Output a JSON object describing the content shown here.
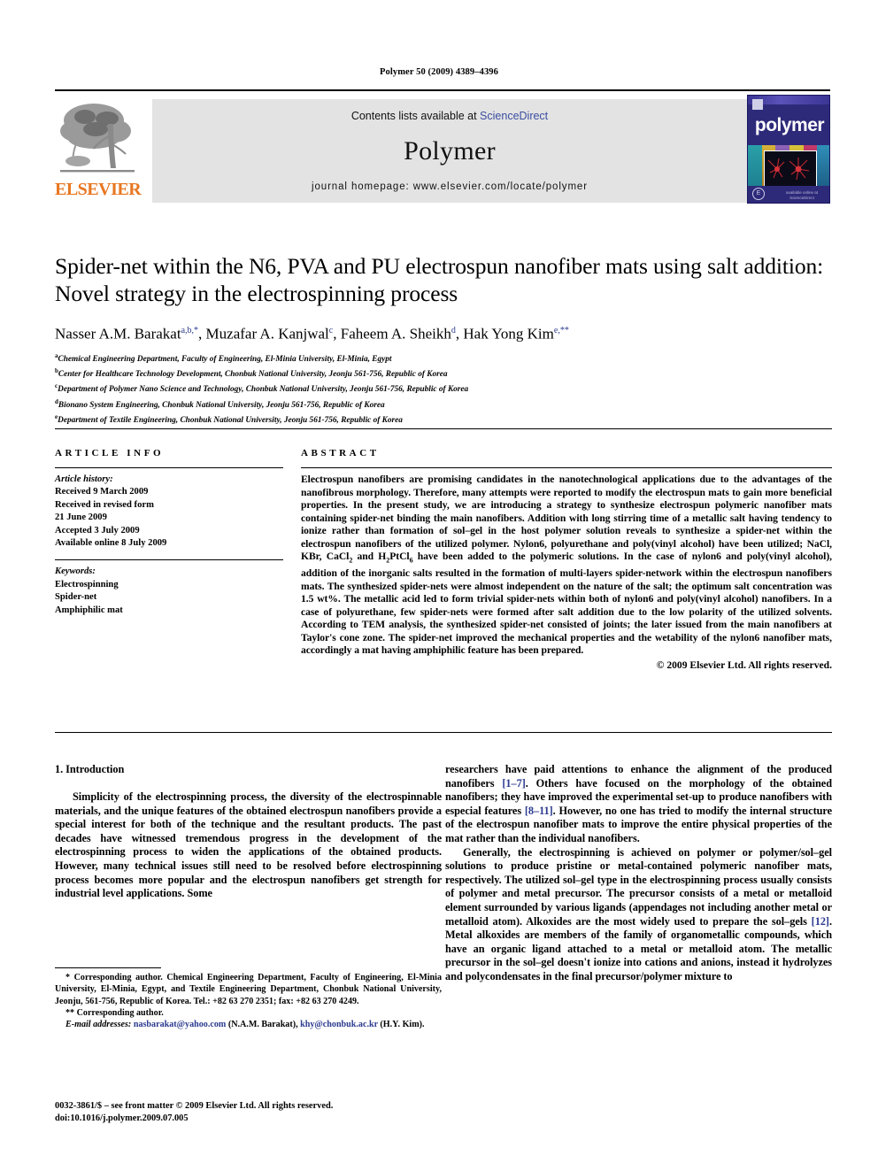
{
  "running_head": "Polymer 50 (2009) 4389–4396",
  "masthead": {
    "publisher_logo_name": "elsevier-tree-logo",
    "publisher_wordmark": "ELSEVIER",
    "contents_prefix": "Contents lists available at ",
    "contents_link": "ScienceDirect",
    "journal_name": "Polymer",
    "homepage_line": "journal homepage: www.elsevier.com/locate/polymer",
    "cover": {
      "title": "polymer",
      "badge": "E",
      "footer_text": "available online at\nScienceDirect"
    }
  },
  "article": {
    "title": "Spider-net within the N6, PVA and PU electrospun nanofiber mats using salt addition: Novel strategy in the electrospinning process",
    "authors_html": "Nasser A.M. Barakat<sup>a,b,</sup><sup>*</sup>, Muzafar A. Kanjwal<sup>c</sup>, Faheem A. Sheikh<sup>d</sup>, Hak Yong Kim<sup>e,</sup><sup>**</sup>",
    "affiliations": [
      {
        "marker": "a",
        "text": "Chemical Engineering Department, Faculty of Engineering, El-Minia University, El-Minia, Egypt"
      },
      {
        "marker": "b",
        "text": "Center for Healthcare Technology Development, Chonbuk National University, Jeonju 561-756, Republic of Korea"
      },
      {
        "marker": "c",
        "text": "Department of Polymer Nano Science and Technology, Chonbuk National University, Jeonju 561-756, Republic of Korea"
      },
      {
        "marker": "d",
        "text": "Bionano System Engineering, Chonbuk National University, Jeonju 561-756, Republic of Korea"
      },
      {
        "marker": "e",
        "text": "Department of Textile Engineering, Chonbuk National University, Jeonju 561-756, Republic of Korea"
      }
    ]
  },
  "article_info": {
    "heading": "ARTICLE INFO",
    "history_label": "Article history:",
    "history": [
      "Received 9 March 2009",
      "Received in revised form",
      "21 June 2009",
      "Accepted 3 July 2009",
      "Available online 8 July 2009"
    ],
    "keywords_label": "Keywords:",
    "keywords": [
      "Electrospinning",
      "Spider-net",
      "Amphiphilic mat"
    ]
  },
  "abstract": {
    "heading": "ABSTRACT",
    "body_html": "Electrospun nanofibers are promising candidates in the nanotechnological applications due to the advantages of the nanofibrous morphology. Therefore, many attempts were reported to modify the electrospun mats to gain more beneficial properties. In the present study, we are introducing a strategy to synthesize electrospun polymeric nanofiber mats containing spider-net binding the main nanofibers. Addition with long stirring time of a metallic salt having tendency to ionize rather than formation of sol–gel in the host polymer solution reveals to synthesize a spider-net within the electrospun nanofibers of the utilized polymer. Nylon6, polyurethane and poly(vinyl alcohol) have been utilized; NaCl, KBr, CaCl<sub>2</sub> and H<sub>2</sub>PtCl<sub>6</sub> have been added to the polymeric solutions. In the case of nylon6 and poly(vinyl alcohol), addition of the inorganic salts resulted in the formation of multi-layers spider-network within the electrospun nanofibers mats. The synthesized spider-nets were almost independent on the nature of the salt; the optimum salt concentration was 1.5 wt%. The metallic acid led to form trivial spider-nets within both of nylon6 and poly(vinyl alcohol) nanofibers. In a case of polyurethane, few spider-nets were formed after salt addition due to the low polarity of the utilized solvents. According to TEM analysis, the synthesized spider-net consisted of joints; the later issued from the main nanofibers at Taylor's cone zone. The spider-net improved the mechanical properties and the wetability of the nylon6 nanofiber mats, accordingly a mat having amphiphilic feature has been prepared.",
    "copyright": "© 2009 Elsevier Ltd. All rights reserved."
  },
  "body": {
    "section_number_title": "1. Introduction",
    "left_paragraph": "Simplicity of the electrospinning process, the diversity of the electrospinnable materials, and the unique features of the obtained electrospun nanofibers provide a special interest for both of the technique and the resultant products. The past decades have witnessed tremendous progress in the development of the electrospinning process to widen the applications of the obtained products. However, many technical issues still need to be resolved before electrospinning process becomes more popular and the electrospun nanofibers get strength for industrial level applications. Some",
    "right_paragraph_1_html": "researchers have paid attentions to enhance the alignment of the produced nanofibers <span class=\"ref\">[1–7]</span>. Others have focused on the morphology of the obtained nanofibers; they have improved the experimental set-up to produce nanofibers with especial features <span class=\"ref\">[8–11]</span>. However, no one has tried to modify the internal structure of the electrospun nanofiber mats to improve the entire physical properties of the mat rather than the individual nanofibers.",
    "right_paragraph_2_html": "Generally, the electrospinning is achieved on polymer or polymer/sol–gel solutions to produce pristine or metal-contained polymeric nanofiber mats, respectively. The utilized sol–gel type in the electrospinning process usually consists of polymer and metal precursor. The precursor consists of a metal or metalloid element surrounded by various ligands (appendages not including another metal or metalloid atom). Alkoxides are the most widely used to prepare the sol–gels <span class=\"ref\">[12]</span>. Metal alkoxides are members of the family of organometallic compounds, which have an organic ligand attached to a metal or metalloid atom. The metallic precursor in the sol–gel doesn't ionize into cations and anions, instead it hydrolyzes and polycondensates in the final precursor/polymer mixture to"
  },
  "footnotes": {
    "corresponding_1_html": "* Corresponding author. Chemical Engineering Department, Faculty of Engineering, El-Minia University, El-Minia, Egypt, and Textile Engineering Department, Chonbuk National University, Jeonju, 561-756, Republic of Korea. Tel.: +82 63 270 2351; fax: +82 63 270 4249.",
    "corresponding_2_html": "** Corresponding author.",
    "email_label": "E-mail addresses:",
    "email_1": "nasbarakat@yahoo.com",
    "email_1_owner": "(N.A.M. Barakat)",
    "email_2": "khy@chonbuk.ac.kr",
    "email_2_owner": "(H.Y. Kim)."
  },
  "imprint": {
    "line1": "0032-3861/$ – see front matter © 2009 Elsevier Ltd. All rights reserved.",
    "line2": "doi:10.1016/j.polymer.2009.07.005"
  },
  "colors": {
    "link": "#2b3a8f",
    "sciencedirect": "#3A4DA0",
    "elsevier_orange": "#E87722",
    "band_gray": "#e3e3e3",
    "cover_blue": "#2e2a7a"
  }
}
